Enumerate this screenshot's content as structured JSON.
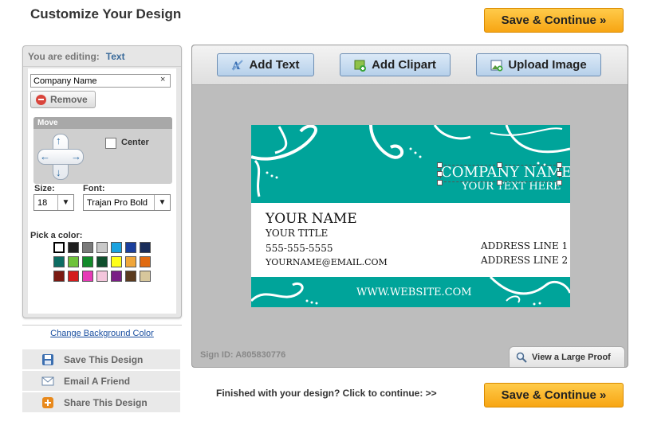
{
  "page": {
    "title": "Customize Your Design",
    "save_continue_label": "Save & Continue »"
  },
  "editing": {
    "label": "You are editing:",
    "value": "Text"
  },
  "text_field": {
    "value": "Company Name",
    "clear_symbol": "×"
  },
  "remove_label": "Remove",
  "move": {
    "header": "Move",
    "center_label": "Center"
  },
  "size": {
    "label": "Size:",
    "value": "18"
  },
  "font": {
    "label": "Font:",
    "value": "Trajan Pro Bold"
  },
  "colors": {
    "label": "Pick a color:",
    "swatches": [
      "#ffffff",
      "#1f1f1f",
      "#7a7a7a",
      "#c9c9c9",
      "#1aa3e0",
      "#1b3f9c",
      "#1a2d5a",
      "#0d6d63",
      "#6fc23a",
      "#138a2a",
      "#0f4f2d",
      "#ffff1a",
      "#f0a63a",
      "#e06a10",
      "#7a1a12",
      "#d41c1c",
      "#e63ab6",
      "#f4c6dc",
      "#7a1f86",
      "#5a3a1e",
      "#d7c79c"
    ]
  },
  "change_background_label": "Change Background Color",
  "actions": {
    "save": "Save This Design",
    "email": "Email A Friend",
    "share": "Share This Design"
  },
  "toolbar": {
    "add_text": "Add Text",
    "add_clipart": "Add Clipart",
    "upload_image": "Upload Image"
  },
  "card": {
    "company": "COMPANY NAME",
    "tagline": "YOUR TEXT HERE",
    "name": "YOUR NAME",
    "title": "YOUR TITLE",
    "phone": "555-555-5555",
    "email": "YOURNAME@EMAIL.COM",
    "address1": "ADDRESS LINE 1",
    "address2": "ADDRESS LINE 2",
    "website": "WWW.WEBSITE.COM",
    "accent_color": "#00a49a"
  },
  "sign_id": "Sign ID: A805830776",
  "proof_label": "View a Large Proof",
  "finished_text": "Finished with your design? Click to continue: >>"
}
